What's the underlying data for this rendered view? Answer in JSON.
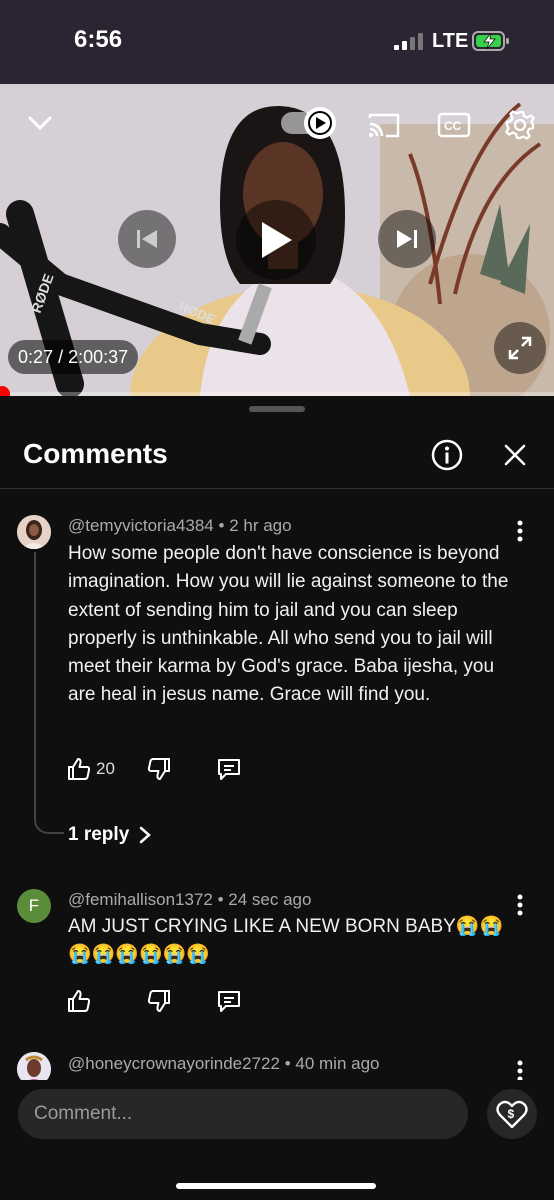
{
  "status_bar": {
    "time": "6:56",
    "network": "LTE",
    "battery_charging": true
  },
  "video": {
    "current_time": "0:27",
    "separator": "/",
    "duration": "2:00:37",
    "progress_fraction": 0.0037,
    "autoplay_on": true,
    "mic_brand_text": "RØDE"
  },
  "comments_panel": {
    "title": "Comments",
    "comments": [
      {
        "author": "@temyvictoria4384",
        "age": "2 hr ago",
        "text": "How some people don't have conscience is beyond imagination. How you will lie against someone to the extent of sending him to jail and you can sleep properly is unthinkable. All who send you to jail will meet their karma by God's grace. Baba ijesha, you are heal in jesus name. Grace will find you.",
        "likes": "20",
        "replies_label": "1 reply"
      },
      {
        "author": "@femihallison1372",
        "age": "24 sec ago",
        "avatar_letter": "F",
        "avatar_color": "#5b8c3a",
        "text": "AM JUST CRYING LIKE A NEW BORN BABY😭😭😭😭😭😭😭😭",
        "likes": ""
      },
      {
        "author": "@honeycrownayorinde2722",
        "age": "40 min ago"
      }
    ],
    "separator": "•",
    "input_placeholder": "Comment..."
  },
  "colors": {
    "accent_red": "#ff0000",
    "background": "#0f0f0f",
    "status_bar_bg": "#2b2533"
  }
}
